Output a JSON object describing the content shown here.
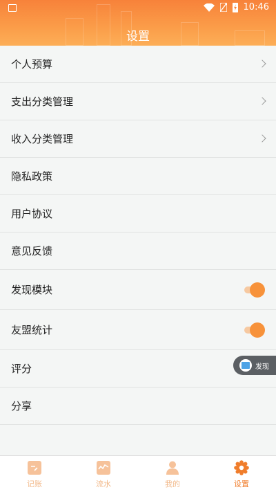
{
  "status_bar": {
    "time": "10:46"
  },
  "header": {
    "title": "设置"
  },
  "settings": {
    "items": [
      {
        "label": "个人预算"
      },
      {
        "label": "支出分类管理"
      },
      {
        "label": "收入分类管理"
      },
      {
        "label": "隐私政策"
      },
      {
        "label": "用户协议"
      },
      {
        "label": "意见反馈"
      },
      {
        "label": "发现模块",
        "toggle": true
      },
      {
        "label": "友盟统计",
        "toggle": true
      },
      {
        "label": "评分"
      },
      {
        "label": "分享"
      }
    ]
  },
  "floating_button": {
    "label": "发现",
    "icon": "news-icon"
  },
  "tabbar": {
    "tabs": [
      {
        "label": "记账",
        "icon": "note-icon"
      },
      {
        "label": "流水",
        "icon": "chart-icon"
      },
      {
        "label": "我的",
        "icon": "person-icon"
      },
      {
        "label": "设置",
        "icon": "gear-icon",
        "active": true
      }
    ]
  },
  "colors": {
    "accent": "#f7923a",
    "header_top": "#f7823a",
    "header_bottom": "#fcae57",
    "tab_inactive": "#f2b98a"
  }
}
